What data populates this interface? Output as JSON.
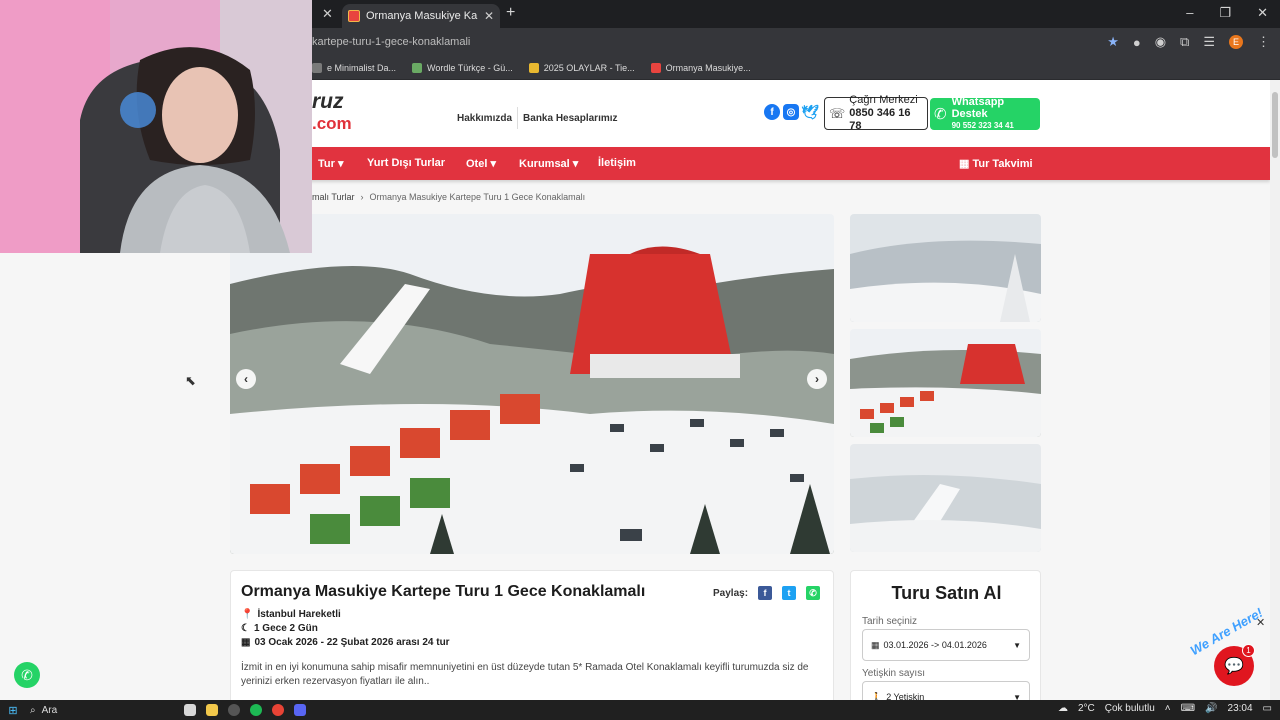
{
  "browser": {
    "active_tab_title": "Ormanya Masukiye Kartepe Tu",
    "url": "kartepe-turu-1-gece-konaklamali",
    "bookmarks": [
      {
        "label": "e Minimalist Da...",
        "color": "#7a7a7a"
      },
      {
        "label": "Wordle Türkçe - Gü...",
        "color": "#6aaa64"
      },
      {
        "label": "2025 OLAYLAR - Tie...",
        "color": "#e8b830"
      },
      {
        "label": "Ormanya Masukiye...",
        "color": "#e8443f"
      }
    ],
    "profile_initial": "E"
  },
  "site": {
    "logo_top": "ruz",
    "logo_bottom": ".com",
    "top_links": [
      "Hakkımızda",
      "Banka Hesaplarımız"
    ],
    "call_center": {
      "title": "Çağrı Merkezi",
      "number": "0850 346 16 78"
    },
    "whatsapp": {
      "title": "Whatsapp Destek",
      "number": "90 552 323 34 41"
    },
    "nav": [
      {
        "label": "Tur ▾"
      },
      {
        "label": "Yurt Dışı Turlar"
      },
      {
        "label": "Otel ▾"
      },
      {
        "label": "Kurumsal ▾"
      },
      {
        "label": "İletişim"
      }
    ],
    "nav_right": "Tur Takvimi",
    "breadcrumb": [
      "malı Turlar",
      "Ormanya Masukiye Kartepe Turu 1 Gece Konaklamalı"
    ]
  },
  "tour": {
    "title": "Ormanya Masukiye Kartepe Turu 1 Gece Konaklamalı",
    "share_label": "Paylaş:",
    "departure": "İstanbul Hareketli",
    "duration": "1 Gece 2 Gün",
    "dates": "03 Ocak 2026 - 22 Şubat 2026 arası 24 tur",
    "description": "İzmit in en iyi konumuna sahip misafir memnuniyetini en üst düzeyde tutan 5* Ramada Otel Konaklamalı keyifli turumuzda siz de yerinizi erken rezervasyon fiyatları ile alın.."
  },
  "purchase": {
    "title": "Turu Satın Al",
    "date_label": "Tarih seçiniz",
    "date_value": "03.01.2026 -> 04.01.2026",
    "adult_label": "Yetişkin sayısı",
    "adult_value": "2 Yetişkin"
  },
  "chat": {
    "badge": "1",
    "tagline": "We Are Here!"
  },
  "taskbar": {
    "search": "Ara",
    "weather": "2°C",
    "weather_text": "Çok bulutlu",
    "time": "23:04"
  },
  "colors": {
    "brand_red": "#e1333f",
    "whatsapp_green": "#25d366"
  }
}
